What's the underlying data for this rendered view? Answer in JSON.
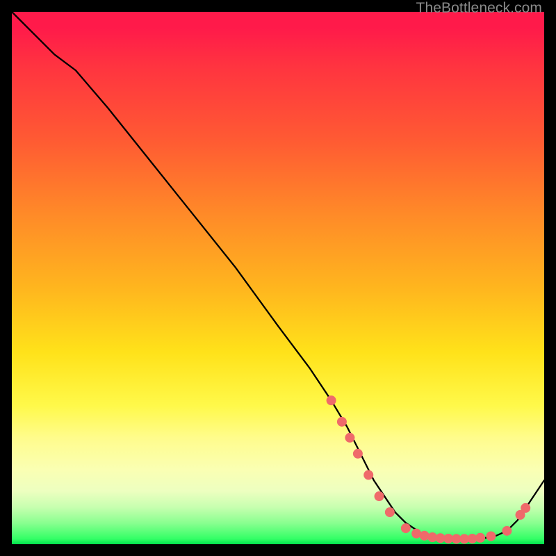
{
  "watermark": "TheBottleneck.com",
  "colors": {
    "background": "#000000",
    "line": "#000000",
    "dot": "#ef6a6a"
  },
  "chart_data": {
    "type": "line",
    "title": "",
    "xlabel": "",
    "ylabel": "",
    "xlim": [
      0,
      100
    ],
    "ylim": [
      0,
      100
    ],
    "grid": false,
    "legend": false,
    "series": [
      {
        "name": "curve",
        "x": [
          0,
          4,
          8,
          12,
          18,
          26,
          34,
          42,
          50,
          56,
          60,
          63,
          65,
          68,
          70,
          72,
          74,
          77,
          80,
          83,
          86,
          89,
          91,
          93,
          95,
          97,
          100
        ],
        "y": [
          100,
          96,
          92,
          89,
          82,
          72,
          62,
          52,
          41,
          33,
          27,
          22,
          18,
          12,
          9,
          6,
          4,
          2,
          1.2,
          1.0,
          1.0,
          1.2,
          1.6,
          2.5,
          4.5,
          7.5,
          12
        ]
      }
    ],
    "annotations": {
      "dots": [
        {
          "x": 60,
          "y": 27
        },
        {
          "x": 62,
          "y": 23
        },
        {
          "x": 63.5,
          "y": 20
        },
        {
          "x": 65,
          "y": 17
        },
        {
          "x": 67,
          "y": 13
        },
        {
          "x": 69,
          "y": 9
        },
        {
          "x": 71,
          "y": 6
        },
        {
          "x": 74,
          "y": 3
        },
        {
          "x": 76,
          "y": 2
        },
        {
          "x": 77.5,
          "y": 1.6
        },
        {
          "x": 79,
          "y": 1.3
        },
        {
          "x": 80.5,
          "y": 1.15
        },
        {
          "x": 82,
          "y": 1.05
        },
        {
          "x": 83.5,
          "y": 1.0
        },
        {
          "x": 85,
          "y": 1.0
        },
        {
          "x": 86.5,
          "y": 1.05
        },
        {
          "x": 88,
          "y": 1.2
        },
        {
          "x": 90,
          "y": 1.5
        },
        {
          "x": 93,
          "y": 2.5
        },
        {
          "x": 95.5,
          "y": 5.5
        },
        {
          "x": 96.5,
          "y": 6.8
        }
      ]
    }
  }
}
